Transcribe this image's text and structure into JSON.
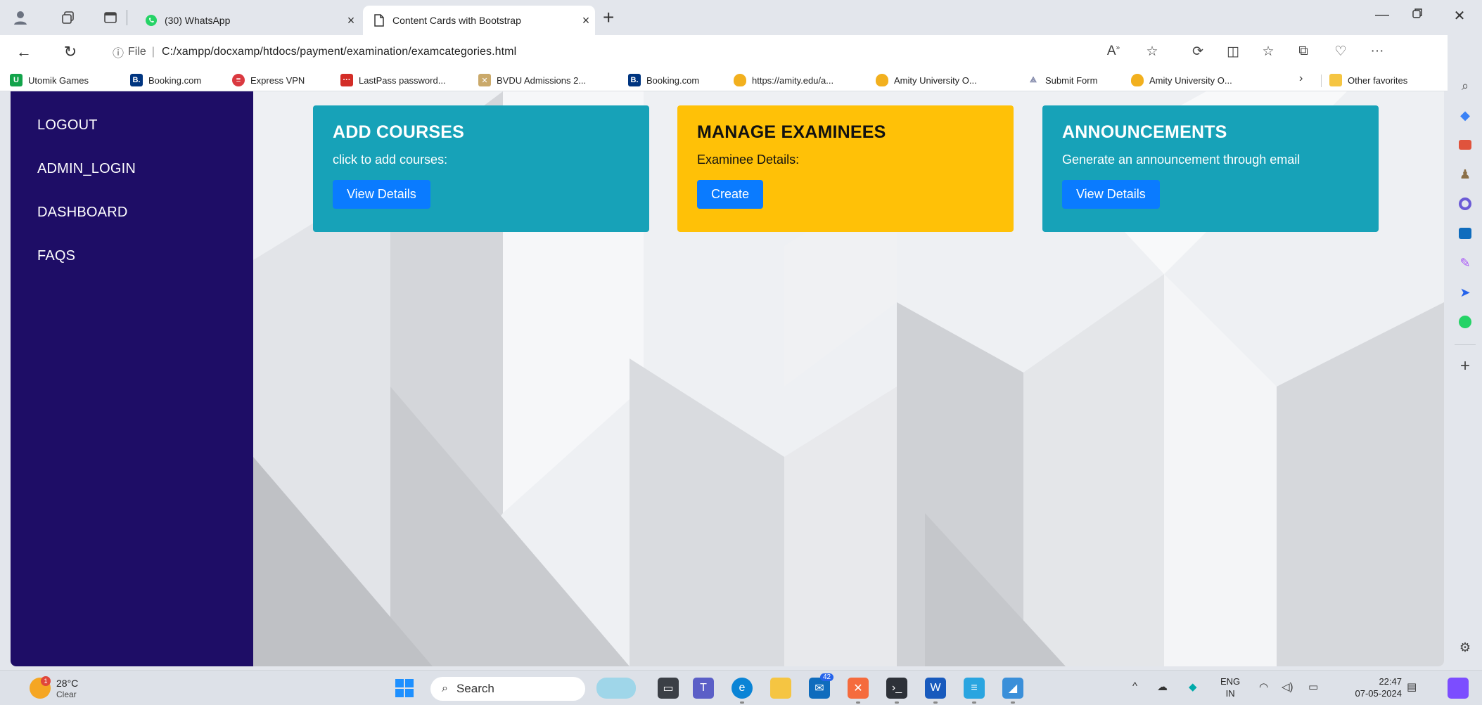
{
  "tabs": [
    {
      "label": "(30) WhatsApp"
    },
    {
      "label": "Content Cards with Bootstrap"
    }
  ],
  "address": {
    "file_label": "File",
    "url": "C:/xampp/docxamp/htdocs/payment/examination/examcategories.html"
  },
  "favorites": [
    {
      "label": "Utomik Games"
    },
    {
      "label": "Booking.com"
    },
    {
      "label": "Express VPN"
    },
    {
      "label": "LastPass password..."
    },
    {
      "label": "BVDU Admissions 2..."
    },
    {
      "label": "Booking.com"
    },
    {
      "label": "https://amity.edu/a..."
    },
    {
      "label": "Amity University O..."
    },
    {
      "label": "Submit Form"
    },
    {
      "label": "Amity University O..."
    }
  ],
  "favorites_other": "Other favorites",
  "sidebar": {
    "links": [
      {
        "label": "LOGOUT"
      },
      {
        "label": "ADMIN_LOGIN"
      },
      {
        "label": "DASHBOARD"
      },
      {
        "label": "FAQS"
      }
    ]
  },
  "cards": [
    {
      "title": "ADD COURSES",
      "text": "click to add courses:",
      "button": "View Details",
      "color": "#17a2b8"
    },
    {
      "title": "MANAGE EXAMINEES",
      "text": "Examinee Details:",
      "button": "Create",
      "color": "#ffc107"
    },
    {
      "title": "ANNOUNCEMENTS",
      "text": "Generate an announcement through email",
      "button": "View Details",
      "color": "#17a2b8"
    }
  ],
  "taskbar": {
    "weather_temp": "28°C",
    "weather_cond": "Clear",
    "weather_badge": "1",
    "search_label": "Search",
    "mail_badge": "42",
    "lang_top": "ENG",
    "lang_bottom": "IN",
    "time": "22:47",
    "date": "07-05-2024"
  },
  "colors": {
    "sidebar_bg": "#1e0d66",
    "button_blue": "#0a7bff",
    "card_teal": "#17a2b8",
    "card_yellow": "#ffc107"
  }
}
